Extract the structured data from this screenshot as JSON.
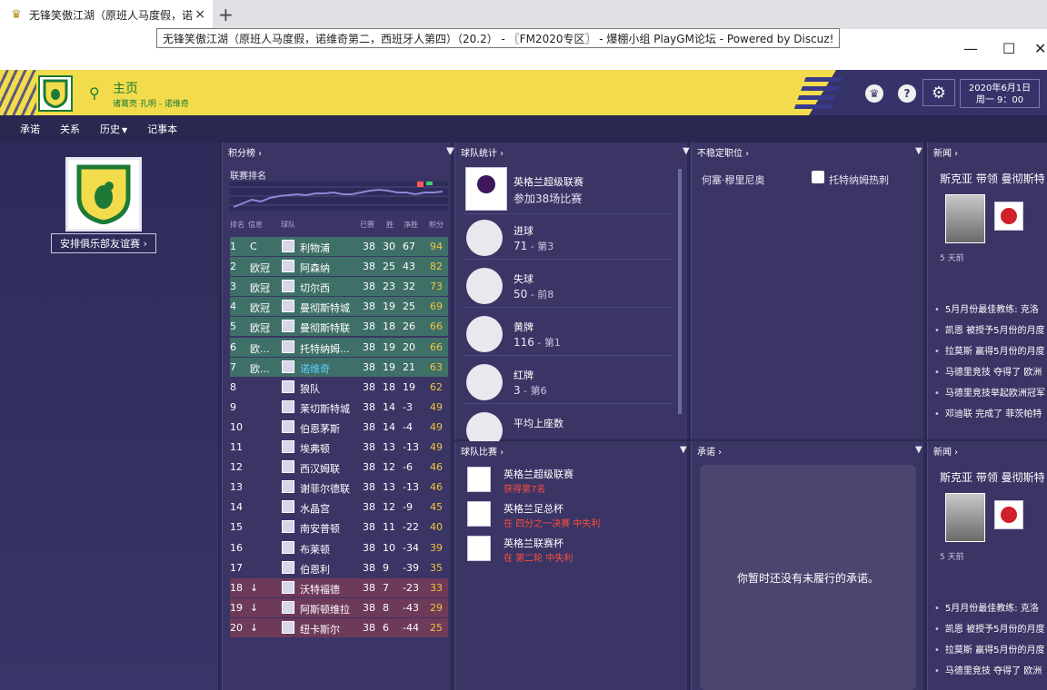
{
  "browser": {
    "tab_title": "无锋笑傲江湖（原班人马度假，诺",
    "tooltip": "无锋笑傲江湖（原班人马度假，诺维奇第二，西班牙人第四）（20.2） - 〖FM2020专区〗 - 爆棚小组 PlayGM论坛 - Powered by Discuz!",
    "close": "×",
    "new_tab": "+",
    "win_min": "—",
    "win_max": "☐",
    "win_close": "✕"
  },
  "header": {
    "title": "主页",
    "subtitle": "诸葛亮 孔明 - 诺维奇",
    "date": "2020年6月1日",
    "time": "周一 9：00"
  },
  "subnav": [
    {
      "label": "承诺",
      "dropdown": false
    },
    {
      "label": "关系",
      "dropdown": false
    },
    {
      "label": "历史",
      "dropdown": true
    },
    {
      "label": "记事本",
      "dropdown": false
    }
  ],
  "left": {
    "friendly_button": "安排俱乐部友谊赛 ›"
  },
  "league": {
    "panel_title": "积分榜 ›",
    "subtitle": "联赛排名",
    "columns": {
      "pos": "排名",
      "info": "信息",
      "team": "球队",
      "played": "已赛",
      "won": "胜",
      "gd": "净胜",
      "pts": "积分"
    },
    "rows": [
      {
        "pos": "1",
        "info": "C",
        "team": "利物浦",
        "played": "38",
        "won": "30",
        "gd": "67",
        "pts": "94"
      },
      {
        "pos": "2",
        "info": "欧冠",
        "team": "阿森纳",
        "played": "38",
        "won": "25",
        "gd": "43",
        "pts": "82"
      },
      {
        "pos": "3",
        "info": "欧冠",
        "team": "切尔西",
        "played": "38",
        "won": "23",
        "gd": "32",
        "pts": "73"
      },
      {
        "pos": "4",
        "info": "欧冠",
        "team": "曼彻斯特城",
        "played": "38",
        "won": "19",
        "gd": "25",
        "pts": "69"
      },
      {
        "pos": "5",
        "info": "欧冠",
        "team": "曼彻斯特联",
        "played": "38",
        "won": "18",
        "gd": "26",
        "pts": "66"
      },
      {
        "pos": "6",
        "info": "欧...",
        "team": "托特纳姆...",
        "played": "38",
        "won": "19",
        "gd": "20",
        "pts": "66"
      },
      {
        "pos": "7",
        "info": "欧...",
        "team": "诺维奇",
        "played": "38",
        "won": "19",
        "gd": "21",
        "pts": "63"
      },
      {
        "pos": "8",
        "info": "",
        "team": "狼队",
        "played": "38",
        "won": "18",
        "gd": "19",
        "pts": "62"
      },
      {
        "pos": "9",
        "info": "",
        "team": "莱切斯特城",
        "played": "38",
        "won": "14",
        "gd": "-3",
        "pts": "49"
      },
      {
        "pos": "10",
        "info": "",
        "team": "伯恩茅斯",
        "played": "38",
        "won": "14",
        "gd": "-4",
        "pts": "49"
      },
      {
        "pos": "11",
        "info": "",
        "team": "埃弗顿",
        "played": "38",
        "won": "13",
        "gd": "-13",
        "pts": "49"
      },
      {
        "pos": "12",
        "info": "",
        "team": "西汉姆联",
        "played": "38",
        "won": "12",
        "gd": "-6",
        "pts": "46"
      },
      {
        "pos": "13",
        "info": "",
        "team": "谢菲尔德联",
        "played": "38",
        "won": "13",
        "gd": "-13",
        "pts": "46"
      },
      {
        "pos": "14",
        "info": "",
        "team": "水晶宫",
        "played": "38",
        "won": "12",
        "gd": "-9",
        "pts": "45"
      },
      {
        "pos": "15",
        "info": "",
        "team": "南安普顿",
        "played": "38",
        "won": "11",
        "gd": "-22",
        "pts": "40"
      },
      {
        "pos": "16",
        "info": "",
        "team": "布莱顿",
        "played": "38",
        "won": "10",
        "gd": "-34",
        "pts": "39"
      },
      {
        "pos": "17",
        "info": "",
        "team": "伯恩利",
        "played": "38",
        "won": "9",
        "gd": "-39",
        "pts": "35"
      },
      {
        "pos": "18",
        "info": "↓",
        "team": "沃特福德",
        "played": "38",
        "won": "7",
        "gd": "-23",
        "pts": "33"
      },
      {
        "pos": "19",
        "info": "↓",
        "team": "阿斯顿维拉",
        "played": "38",
        "won": "8",
        "gd": "-43",
        "pts": "29"
      },
      {
        "pos": "20",
        "info": "↓",
        "team": "纽卡斯尔",
        "played": "38",
        "won": "6",
        "gd": "-44",
        "pts": "25"
      }
    ]
  },
  "stats": {
    "panel_title": "球队统计 ›",
    "league": {
      "name": "英格兰超级联赛",
      "detail": "参加38场比赛"
    },
    "items": [
      {
        "label": "进球",
        "value": "71",
        "rank": " - 第3"
      },
      {
        "label": "失球",
        "value": "50",
        "rank": " - 前8"
      },
      {
        "label": "黄牌",
        "value": "116",
        "rank": " - 第1"
      },
      {
        "label": "红牌",
        "value": "3",
        "rank": " - 第6"
      },
      {
        "label": "平均上座数",
        "value": "",
        "rank": ""
      }
    ]
  },
  "competitions": {
    "panel_title": "球队比赛 ›",
    "items": [
      {
        "name": "英格兰超级联赛",
        "status": "获得第7名"
      },
      {
        "name": "英格兰足总杯",
        "status": "在 四分之一决赛 中失利"
      },
      {
        "name": "英格兰联赛杯",
        "status": "在 第二轮 中失利"
      }
    ]
  },
  "unsettled": {
    "panel_title": "不稳定职位 ›",
    "player": "何塞·穆里尼奥",
    "club": "托特纳姆热刺"
  },
  "promises": {
    "panel_title": "承诺 ›",
    "empty_text": "你暂时还没有未履行的承诺。"
  },
  "news": [
    {
      "panel_title": "新闻 ›",
      "headline": "斯克亚 带领 曼彻斯特",
      "age": "5 天前",
      "items": [
        "5月月份最佳教练: 克洛",
        "凯恩 被授予5月份的月度",
        "拉莫斯 赢得5月份的月度",
        "马德里竞技 夺得了 欧洲",
        "马德里竞技举起欧洲冠军",
        "邓迪联 完成了 菲茨帕特"
      ]
    },
    {
      "panel_title": "新闻 ›",
      "headline": "斯克亚 带领 曼彻斯特",
      "age": "5 天前",
      "items": [
        "5月月份最佳教练: 克洛",
        "凯恩 被授予5月份的月度",
        "拉莫斯 赢得5月份的月度",
        "马德里竞技 夺得了 欧洲"
      ]
    }
  ],
  "colors": {
    "brand_yellow": "#f2dc4b",
    "brand_green": "#1c7a36",
    "points": "#f2c53a",
    "loss_red": "#ff4d3d",
    "highlight_blue": "#5bd3ff"
  },
  "icons": {
    "tab_favicon": "trophy-icon",
    "search": "search-icon",
    "help": "help-icon",
    "settings": "gear-icon"
  }
}
